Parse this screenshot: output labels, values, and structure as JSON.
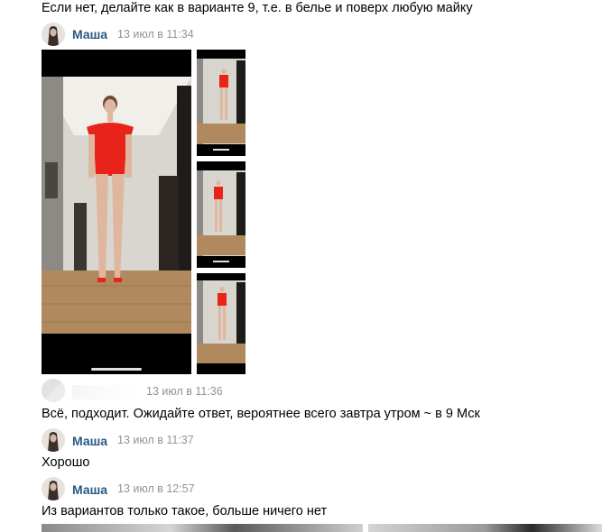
{
  "messages": [
    {
      "text": "Если нет, делайте как в варианте 9, т.е. в белье и поверх любую майку"
    },
    {
      "author": "Маша",
      "time": "13 июл в 11:34",
      "photos": [
        {
          "name": "photo-main"
        },
        {
          "name": "photo-thumb-1"
        },
        {
          "name": "photo-thumb-2"
        },
        {
          "name": "photo-thumb-3"
        }
      ]
    },
    {
      "author": "",
      "time": "13 июл в 11:36",
      "text": "Всё, подходит. Ожидайте ответ, вероятнее всего завтра утром ~ в 9 Мск"
    },
    {
      "author": "Маша",
      "time": "13 июл в 11:37",
      "text": "Хорошо"
    },
    {
      "author": "Маша",
      "time": "13 июл в 12:57",
      "text": "Из вариантов только такое, больше ничего нет"
    }
  ],
  "colors": {
    "author": "#2a5885",
    "time": "#939393",
    "swimsuit": "#e8231a"
  }
}
